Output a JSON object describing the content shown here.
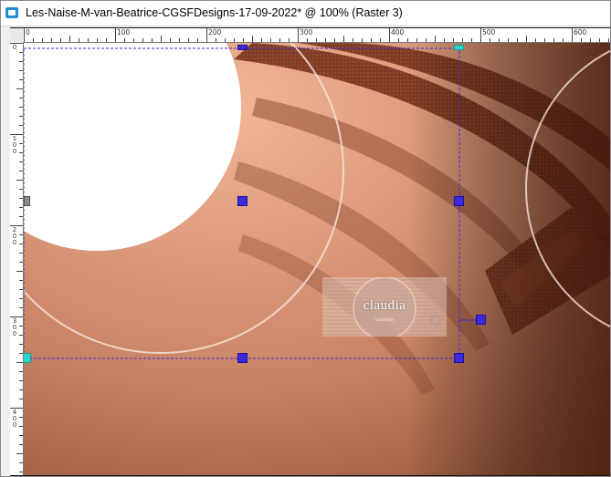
{
  "window": {
    "title": "Les-Naise-M-van-Beatrice-CGSFDesigns-17-09-2022* @ 100% (Raster 3)"
  },
  "rulers": {
    "horizontal_labels": [
      "0",
      "100",
      "200",
      "300",
      "400",
      "500",
      "600"
    ],
    "vertical_labels": [
      "0",
      "1\n0\n0",
      "2\n0\n0",
      "3\n0\n0",
      "4\n0\n0"
    ]
  },
  "watermark": {
    "text": "claudia",
    "subtext": "tutoriels"
  },
  "colors": {
    "accent_handle": "#3b2bd8",
    "cyan_handle": "#29d6d0",
    "canvas_base": "#c98467",
    "stripe_dark": "#6b2a16"
  }
}
